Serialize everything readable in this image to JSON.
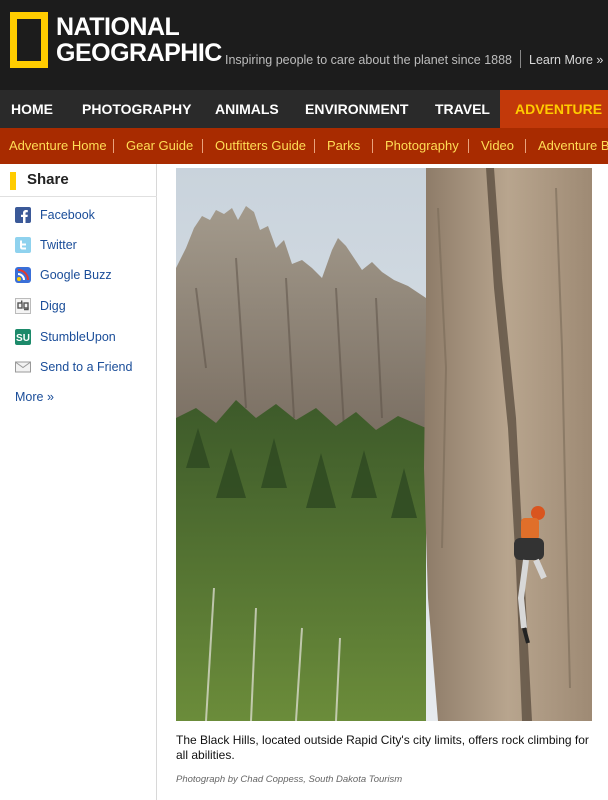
{
  "header": {
    "logo_line1": "NATIONAL",
    "logo_line2": "GEOGRAPHIC",
    "tagline": "Inspiring people to care about the planet since 1888",
    "learn_more": "Learn More »",
    "brand_colors": {
      "yellow": "#ffcc00",
      "header_bg": "#1c1c1c"
    }
  },
  "mainnav": {
    "items": [
      "HOME",
      "PHOTOGRAPHY",
      "ANIMALS",
      "ENVIRONMENT",
      "TRAVEL",
      "ADVENTURE"
    ],
    "active": "ADVENTURE",
    "active_color": "#c2390a"
  },
  "subnav": {
    "items": [
      "Adventure Home",
      "Gear Guide",
      "Outfitters Guide",
      "Parks",
      "Photography",
      "Video",
      "Adventure Bl"
    ],
    "bg_color": "#a82b00"
  },
  "share": {
    "title": "Share",
    "items": [
      {
        "label": "Facebook",
        "icon": "facebook-icon"
      },
      {
        "label": "Twitter",
        "icon": "twitter-icon"
      },
      {
        "label": "Google Buzz",
        "icon": "google-buzz-icon"
      },
      {
        "label": "Digg",
        "icon": "digg-icon"
      },
      {
        "label": "StumbleUpon",
        "icon": "stumbleupon-icon"
      },
      {
        "label": "Send to a Friend",
        "icon": "envelope-icon"
      }
    ],
    "more": "More »"
  },
  "photo": {
    "caption": "The Black Hills, located outside Rapid City's city limits, offers rock climbing for all abilities.",
    "credit": "Photograph by Chad Coppess, South Dakota Tourism"
  }
}
